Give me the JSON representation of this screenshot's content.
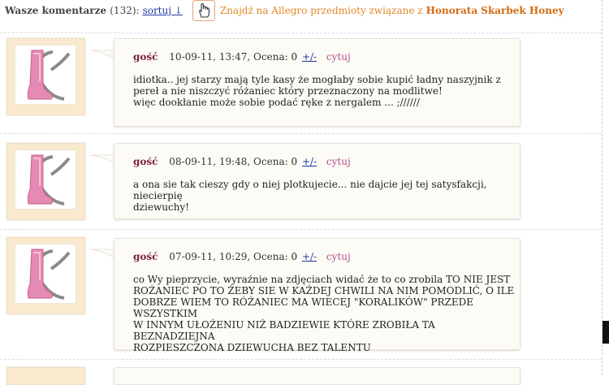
{
  "header": {
    "title": "Wasze komentarze",
    "count": "(132):",
    "sort_label": "sortuj",
    "sort_arrow": "↓",
    "allegro_text": "Znajdź na Allegro przedmioty związane z",
    "allegro_link": "Honorata Skarbek Honey"
  },
  "comments": [
    {
      "author": "gość",
      "date": "10-09-11, 13:47, Ocena:",
      "score": "0",
      "pm": "+/-",
      "quote": "cytuj",
      "text": "idiotka.. jej starzy mają tyle kasy że mogłaby sobie kupić ładny naszyjnik z\npereł a nie niszczyć różaniec który przeznaczony na modlitwe!\nwięc dookłanie może sobie podać ręke z nergalem ... ;//////"
    },
    {
      "author": "gość",
      "date": "08-09-11, 19:48, Ocena:",
      "score": "0",
      "pm": "+/-",
      "quote": "cytuj",
      "text": "a ona sie tak cieszy gdy o niej plotkujecie... nie dajcie jej tej satysfakcji, niecierpię\ndziewuchy!"
    },
    {
      "author": "gość",
      "date": "07-09-11, 10:29, Ocena:",
      "score": "0",
      "pm": "+/-",
      "quote": "cytuj",
      "text": "co Wy pieprzycie, wyraźnie na zdjęciach widać że to co zrobila TO NIE JEST\nROŻANIEC PO TO ŻEBY SIE W KAŻDEJ CHWILI NA NIM POMODLIĆ, O ILE\nDOBRZE WIEM TO RÓŻANIEC MA WIECEJ \"KORALIKÓW\" PRZEDE WSZYSTKIM\nW INNYM UŁOŻENIU NIŻ BADZIEWIE KTÓRE ZROBIŁA TA BEZNADZIEJNA\nROZPIESZCZONA DZIEWUCHA BEZ TALENTU"
    }
  ],
  "colors": {
    "author": "#7a1f3c",
    "link": "#1e3a9c",
    "quote": "#b2508a",
    "allegro": "#d46a12",
    "avatar_bg": "#f8e9cf"
  }
}
